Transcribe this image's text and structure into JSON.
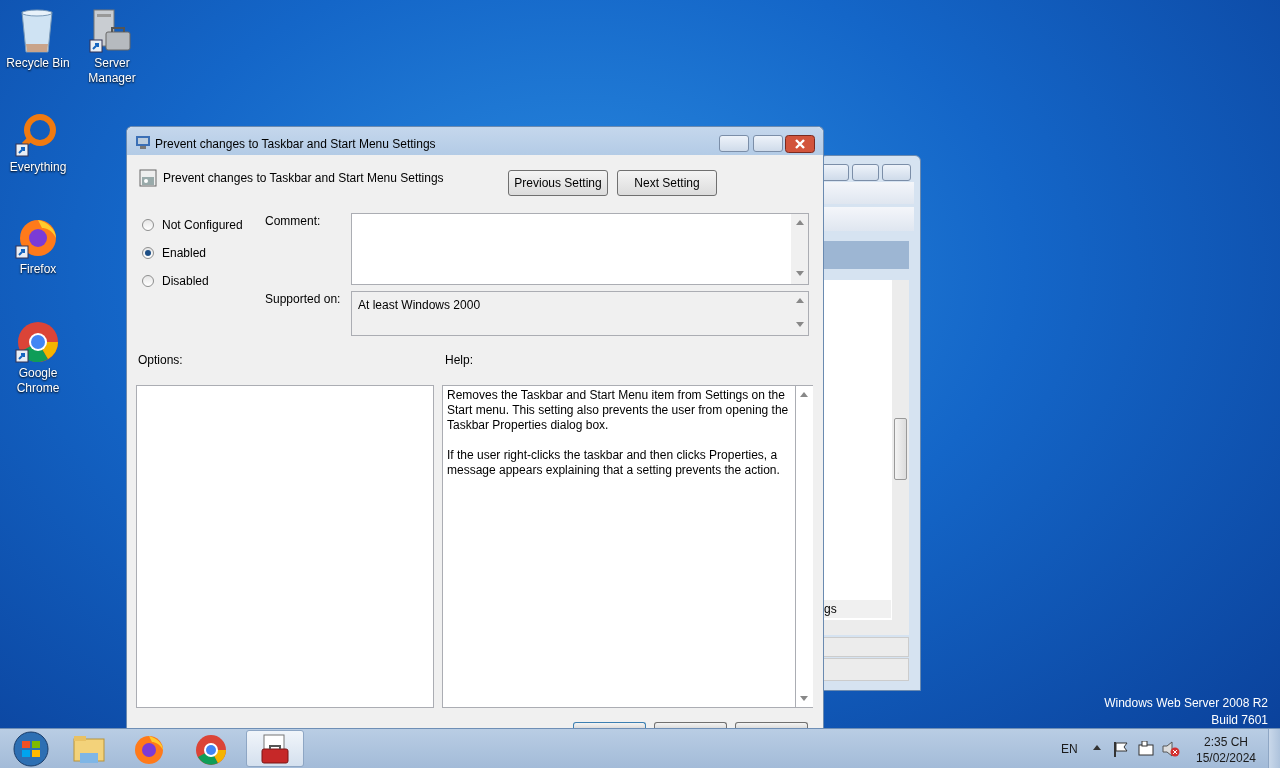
{
  "desktop_icons": [
    {
      "label": "Recycle Bin",
      "kind": "recycle"
    },
    {
      "label": "Server Manager",
      "kind": "server"
    },
    {
      "label": "Everything",
      "kind": "everything"
    },
    {
      "label": "Firefox",
      "kind": "firefox"
    },
    {
      "label": "Google Chrome",
      "kind": "chrome"
    }
  ],
  "background_window": {
    "row_text": "gs"
  },
  "dialog": {
    "title": "Prevent changes to Taskbar and Start Menu Settings",
    "setting_name": "Prevent changes to Taskbar and Start Menu Settings",
    "nav_buttons": [
      "Previous Setting",
      "Next Setting"
    ],
    "states": [
      {
        "label": "Not Configured",
        "selected": false
      },
      {
        "label": "Enabled",
        "selected": true
      },
      {
        "label": "Disabled",
        "selected": false
      }
    ],
    "comment_label": "Comment:",
    "supported_label": "Supported on:",
    "supported_value": "At least Windows 2000",
    "options_label": "Options:",
    "help_label": "Help:",
    "help_paragraphs": [
      "Removes the Taskbar and Start Menu item from Settings on the Start menu. This setting also prevents the user from opening the Taskbar Properties dialog box.",
      "If the user right-clicks the taskbar and then clicks Properties, a message appears explaining that a setting prevents the action."
    ]
  },
  "os_edition": [
    "Windows Web Server 2008 R2",
    "Build 7601"
  ],
  "taskbar": {
    "apps": [
      {
        "kind": "explorer",
        "selected": false
      },
      {
        "kind": "firefox",
        "selected": false
      },
      {
        "kind": "chrome",
        "selected": false
      },
      {
        "kind": "toolbox",
        "selected": true
      }
    ],
    "language": "EN",
    "time": "2:35 CH",
    "date": "15/02/2024"
  }
}
